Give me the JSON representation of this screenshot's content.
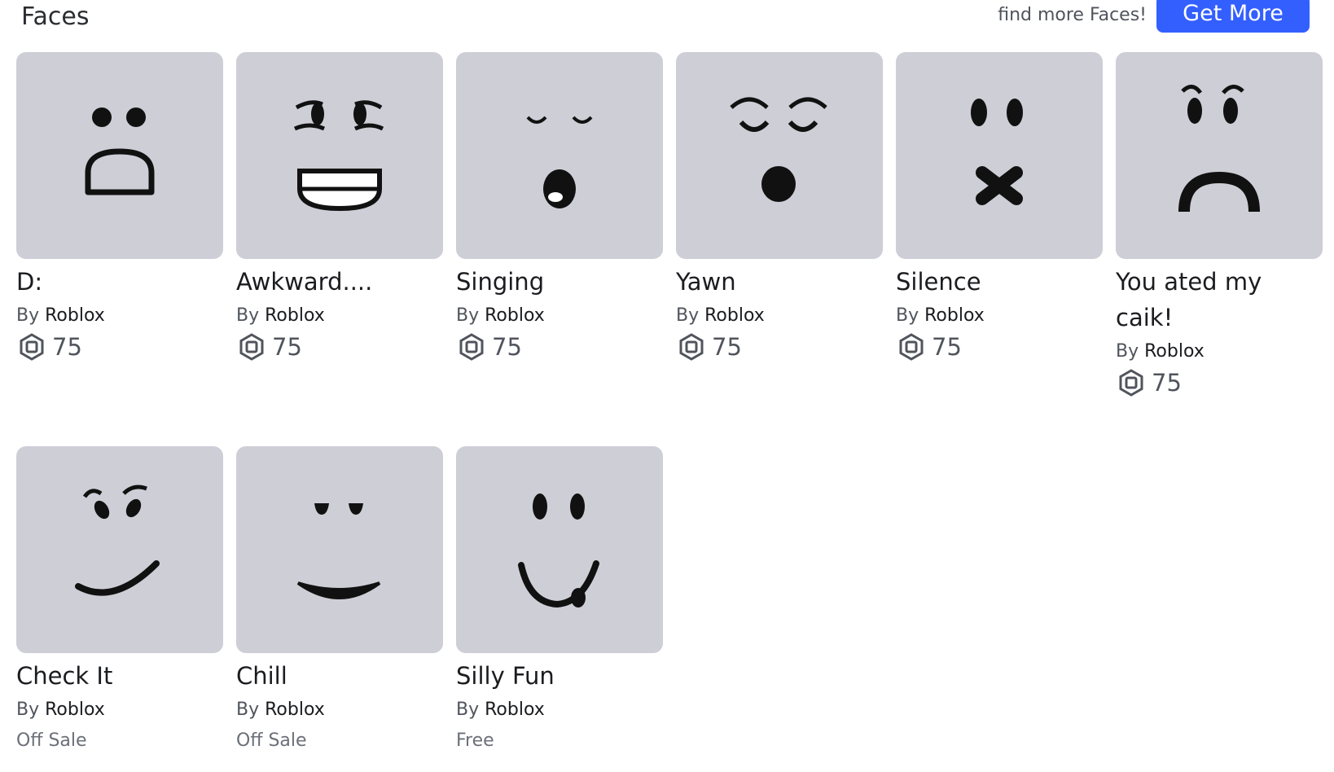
{
  "section": {
    "title": "Faces",
    "hint": "find more Faces!",
    "get_more_label": "Get More"
  },
  "items": [
    {
      "name": "D:",
      "by": "By",
      "creator": "Roblox",
      "price": "75",
      "face": "d-face-icon"
    },
    {
      "name": "Awkward....",
      "by": "By",
      "creator": "Roblox",
      "price": "75",
      "face": "awkward-face-icon"
    },
    {
      "name": "Singing",
      "by": "By",
      "creator": "Roblox",
      "price": "75",
      "face": "singing-face-icon"
    },
    {
      "name": "Yawn",
      "by": "By",
      "creator": "Roblox",
      "price": "75",
      "face": "yawn-face-icon"
    },
    {
      "name": "Silence",
      "by": "By",
      "creator": "Roblox",
      "price": "75",
      "face": "silence-face-icon"
    },
    {
      "name": "You ated my caik!",
      "by": "By",
      "creator": "Roblox",
      "price": "75",
      "face": "sad-face-icon"
    },
    {
      "name": "Check It",
      "by": "By",
      "creator": "Roblox",
      "status": "Off Sale",
      "face": "check-it-face-icon"
    },
    {
      "name": "Chill",
      "by": "By",
      "creator": "Roblox",
      "status": "Off Sale",
      "face": "chill-face-icon"
    },
    {
      "name": "Silly Fun",
      "by": "By",
      "creator": "Roblox",
      "status": "Free",
      "face": "silly-fun-face-icon"
    }
  ],
  "colors": {
    "accent": "#335fff",
    "thumb_bg": "#cdced6"
  }
}
